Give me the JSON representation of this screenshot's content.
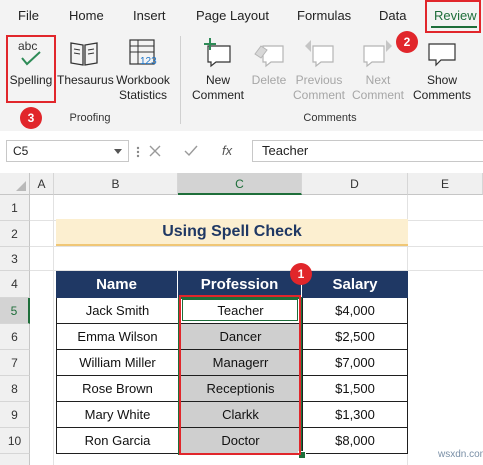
{
  "ribbon": {
    "tabs": [
      "File",
      "Home",
      "Insert",
      "Page Layout",
      "Formulas",
      "Data",
      "Review"
    ],
    "groups": {
      "proofing": {
        "label": "Proofing",
        "buttons": [
          {
            "label": "Spelling",
            "icon": "spelling-abc-icon"
          },
          {
            "label": "Thesaurus",
            "icon": "book-icon"
          },
          {
            "label_line1": "Workbook",
            "label_line2": "Statistics",
            "icon": "statistics-icon"
          }
        ]
      },
      "comments": {
        "label": "Comments",
        "buttons": [
          {
            "label_line1": "New",
            "label_line2": "Comment",
            "icon": "new-comment-icon",
            "enabled": true
          },
          {
            "label": "Delete",
            "icon": "delete-comment-icon",
            "enabled": false
          },
          {
            "label_line1": "Previous",
            "label_line2": "Comment",
            "icon": "previous-comment-icon",
            "enabled": false
          },
          {
            "label_line1": "Next",
            "label_line2": "Comment",
            "icon": "next-comment-icon",
            "enabled": false
          },
          {
            "label_line1": "Show",
            "label_line2": "Comments",
            "icon": "show-comments-icon",
            "enabled": true
          }
        ]
      }
    },
    "callouts": [
      "2",
      "3",
      "1"
    ]
  },
  "formula_bar": {
    "name_box": "C5",
    "fx": "fx",
    "value": "Teacher"
  },
  "grid": {
    "columns": [
      "A",
      "B",
      "C",
      "D",
      "E"
    ],
    "rows": [
      "1",
      "2",
      "3",
      "4",
      "5",
      "6",
      "7",
      "8",
      "9",
      "10"
    ],
    "selected_column": "C",
    "selected_row": "5"
  },
  "sheet": {
    "title": "Using Spell Check",
    "headers": [
      "Name",
      "Profession",
      "Salary"
    ],
    "rows": [
      [
        "Jack Smith",
        "Teacher",
        "$4,000"
      ],
      [
        "Emma Wilson",
        "Dancer",
        "$2,500"
      ],
      [
        "William Miller",
        "Managerr",
        "$7,000"
      ],
      [
        "Rose Brown",
        "Receptionis",
        "$1,500"
      ],
      [
        "Mary White",
        "Clarkk",
        "$1,300"
      ],
      [
        "Ron Garcia",
        "Doctor",
        "$8,000"
      ]
    ]
  },
  "colors": {
    "header_bg": "#1f3864",
    "title_bg": "#fcefd0",
    "callout_red": "#e1262b",
    "excel_green": "#1e6e3a"
  },
  "watermark": "wsxdn.com"
}
